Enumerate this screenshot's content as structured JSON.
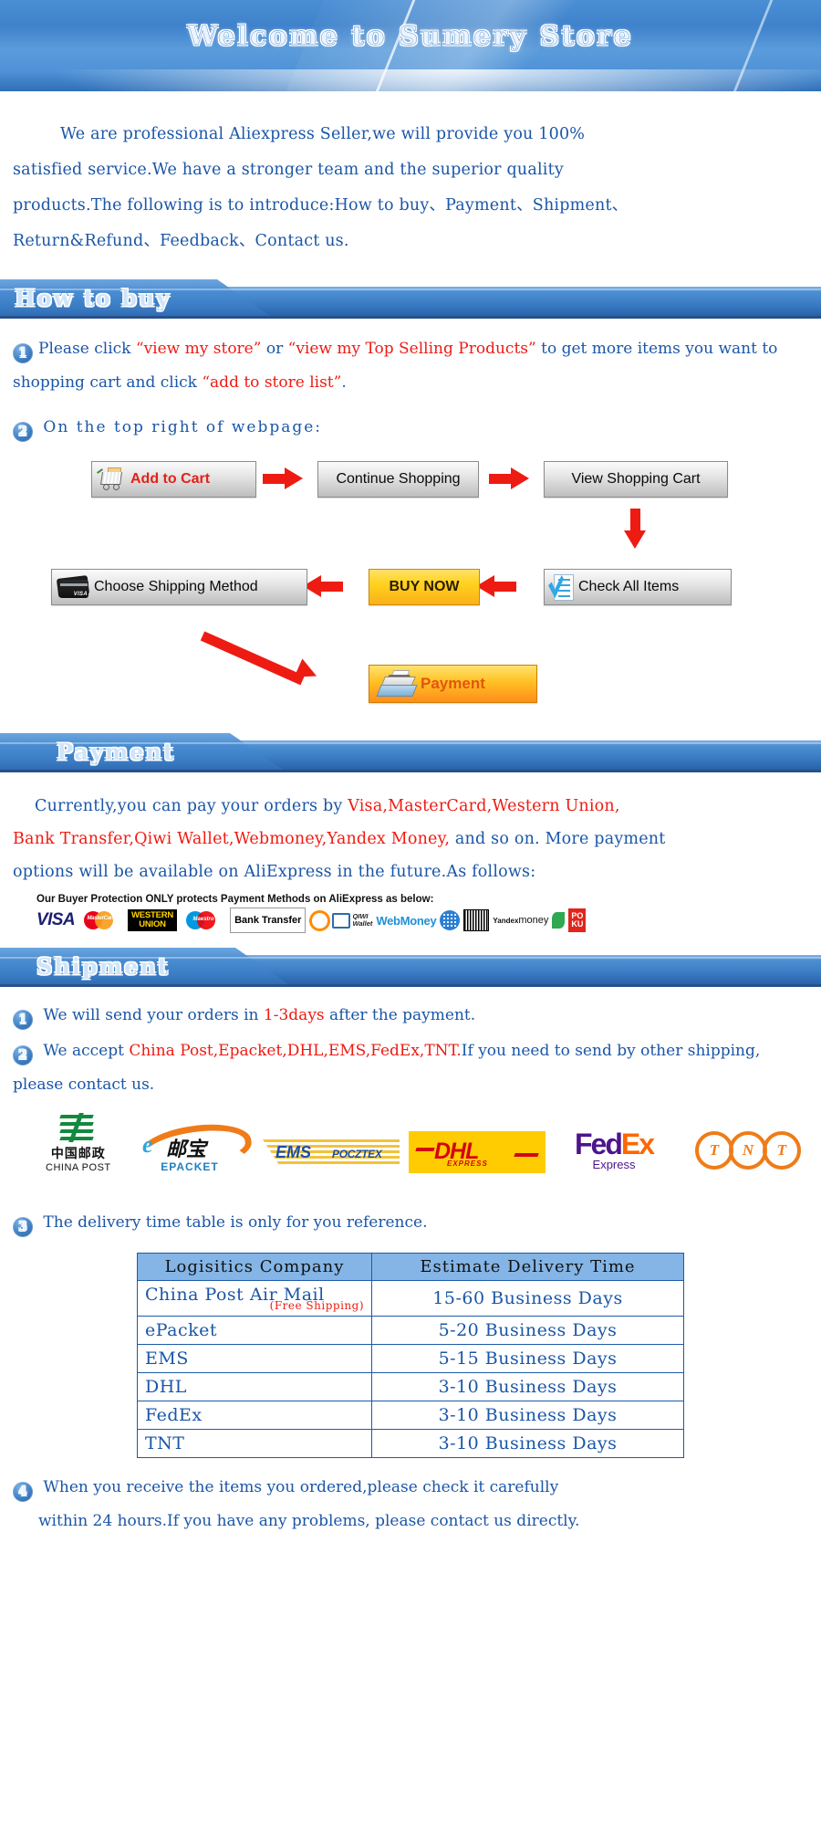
{
  "hero": {
    "title": "Welcome to Sumery Store"
  },
  "intro": {
    "line1": "We are professional Aliexpress Seller,we will provide you 100%",
    "line2": "satisfied service.We have a stronger team and the superior quality",
    "line3": "products.The following is to introduce:How to buy、Payment、Shipment、",
    "line4": "Return&Refund、Feedback、Contact us."
  },
  "sections": {
    "how_to_buy": "How to buy",
    "payment": "Payment",
    "shipment": "Shipment"
  },
  "how_to_buy": {
    "item1": {
      "num": "1",
      "p1": "Please click",
      "q1": "“view my store”",
      "p2": "or",
      "q2": "“view my Top Selling Products”",
      "p3": "to get more items you want to shopping cart and click",
      "q3": "“add to store list”",
      "p4": "."
    },
    "item2": {
      "num": "2",
      "text": "On the top right of webpage:"
    }
  },
  "flow": {
    "add_to_cart": "Add to Cart",
    "continue_shopping": "Continue Shopping",
    "view_shopping_cart": "View Shopping Cart",
    "check_all_items": "Check All Items",
    "buy_now": "BUY NOW",
    "choose_shipping_method": "Choose Shipping Method",
    "payment": "Payment"
  },
  "payment": {
    "line1_blue_a": "Currently,you can pay your orders by ",
    "line1_red": "Visa,MasterCard,Western Union,",
    "line2_red": "Bank Transfer,Qiwi Wallet,Webmoney,Yandex Money,",
    "line2_blue": " and so on. More payment",
    "line3": "options will be available on AliExpress in the future.As follows:",
    "protection_caption": "Our Buyer Protection ONLY protects Payment Methods on AliExpress as below:",
    "logos": [
      "VISA",
      "MasterCard",
      "WESTERN UNION",
      "Maestro",
      "Bank Transfer",
      "QIWI Wallet",
      "WebMoney",
      "Yandex",
      "BOLETO",
      "Yandex money",
      "Sberbank",
      "QIWI RU"
    ]
  },
  "shipment": {
    "item1": {
      "num": "1",
      "pre": "We will send your orders in ",
      "red": "1-3days",
      "post": " after the payment."
    },
    "item2": {
      "num": "2",
      "pre": "We accept ",
      "red": "China Post,Epacket,DHL,EMS,FedEx,TNT.",
      "post": "If you need to send by other shipping, please contact us."
    },
    "item3": {
      "num": "3",
      "text": "The delivery time table is only for you reference."
    },
    "item4": {
      "num": "4",
      "line1": "When you receive the items you ordered,please check it carefully",
      "line2": "within 24 hours.If you have any problems, please contact us directly."
    },
    "carriers": [
      {
        "name": "CHINA POST",
        "cn": "中国邮政"
      },
      {
        "name": "EPACKET",
        "cn": "邮宝"
      },
      {
        "name": "EMS POCZTEX",
        "cn": ""
      },
      {
        "name": "DHL EXPRESS",
        "cn": ""
      },
      {
        "name": "FedEx Express",
        "cn": ""
      },
      {
        "name": "TNT",
        "cn": ""
      }
    ]
  },
  "delivery_table": {
    "headers": [
      "Logisitics Company",
      "Estimate Delivery Time"
    ],
    "rows": [
      {
        "company": "China Post Air Mail",
        "note": "(Free Shipping)",
        "time": "15-60 Business Days"
      },
      {
        "company": "ePacket",
        "note": "",
        "time": "5-20 Business Days"
      },
      {
        "company": "EMS",
        "note": "",
        "time": "5-15 Business Days"
      },
      {
        "company": "DHL",
        "note": "",
        "time": "3-10 Business Days"
      },
      {
        "company": "FedEx",
        "note": "",
        "time": "3-10 Business Days"
      },
      {
        "company": "TNT",
        "note": "",
        "time": "3-10 Business Days"
      }
    ]
  },
  "colors": {
    "blue_text": "#1a56a8",
    "red_text": "#ee1b12",
    "banner_blue": "#3b7dc5",
    "table_header": "#84b5e6"
  }
}
